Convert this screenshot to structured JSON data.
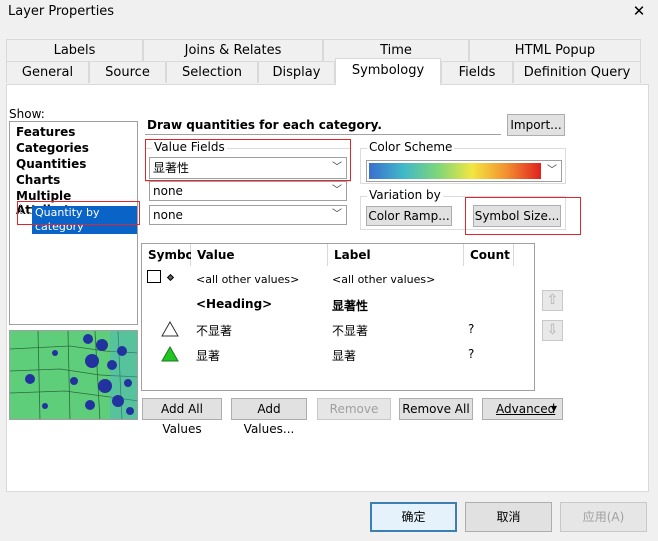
{
  "window": {
    "title": "Layer Properties",
    "close_glyph": "✕"
  },
  "tabs_row1": [
    "Labels",
    "Joins & Relates",
    "Time",
    "HTML Popup"
  ],
  "tabs_row2": [
    "General",
    "Source",
    "Selection",
    "Display",
    "Symbology",
    "Fields",
    "Definition Query"
  ],
  "active_tab": "Symbology",
  "show": {
    "label": "Show:",
    "items": [
      "Features",
      "Categories",
      "Quantities",
      "Charts",
      "Multiple Attributes"
    ],
    "selected_sub": "Quantity by category"
  },
  "header_text": "Draw quantities for each category.",
  "import_label": "Import...",
  "value_fields": {
    "label": "Value Fields",
    "field1": "显著性",
    "field2": "none",
    "field3": "none"
  },
  "color_scheme": {
    "label": "Color Scheme"
  },
  "variation": {
    "label": "Variation by",
    "color_ramp_label": "Color Ramp...",
    "symbol_size_label": "Symbol Size..."
  },
  "table": {
    "headers": [
      "Symbol",
      "Value",
      "Label",
      "Count"
    ],
    "rows": [
      {
        "value": "<all other values>",
        "label": "<all other values>",
        "count": ""
      },
      {
        "value": "<Heading>",
        "label": "显著性",
        "count": ""
      },
      {
        "value": "不显著",
        "label": "不显著",
        "count": "?"
      },
      {
        "value": "显著",
        "label": "显著",
        "count": "?"
      }
    ]
  },
  "bottom_buttons": {
    "add_all": "Add All Values",
    "add_values": "Add Values...",
    "remove": "Remove",
    "remove_all": "Remove All",
    "advanced": "Advanced"
  },
  "dialog_buttons": {
    "ok": "确定",
    "cancel": "取消",
    "apply": "应用(A)"
  },
  "colors": {
    "accent_red": "#e0262c",
    "selection_blue": "#0a64c8",
    "map_green": "#5fce7a",
    "triangle_green": "#22c522"
  }
}
